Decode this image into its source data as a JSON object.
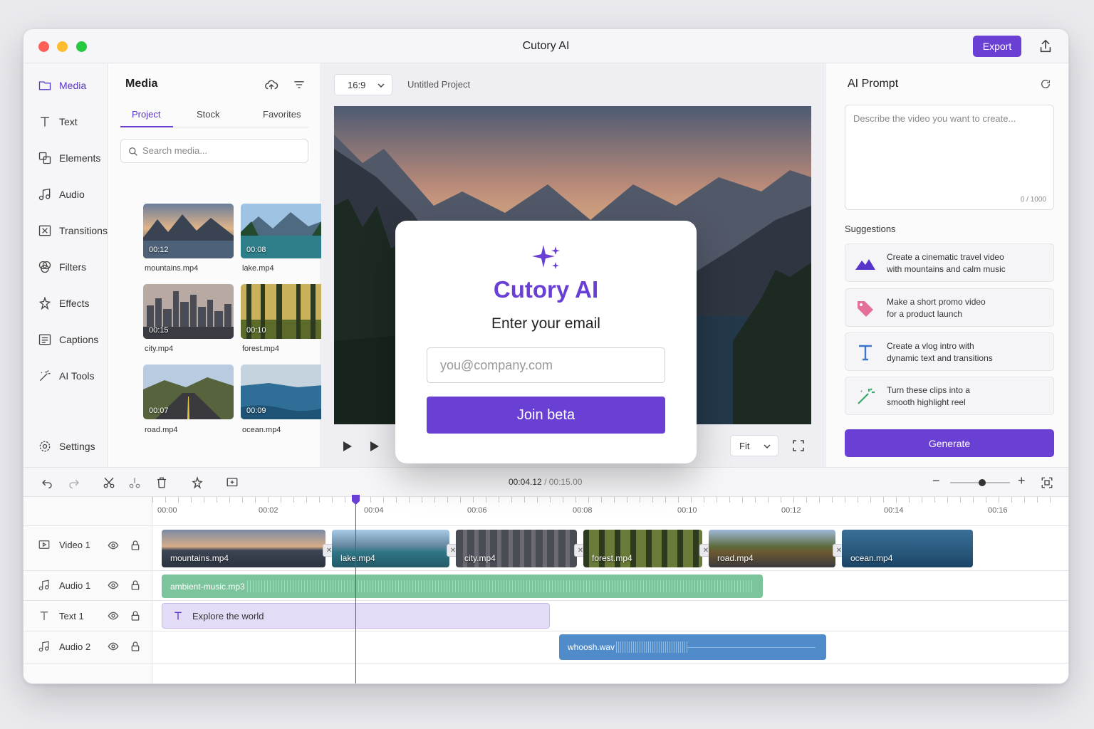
{
  "app": {
    "title": "Cutory AI",
    "export_label": "Export"
  },
  "nav": {
    "items": [
      {
        "label": "Media",
        "icon": "folder-icon"
      },
      {
        "label": "Text",
        "icon": "text-icon"
      },
      {
        "label": "Elements",
        "icon": "elements-icon"
      },
      {
        "label": "Audio",
        "icon": "music-note-icon"
      },
      {
        "label": "Transitions",
        "icon": "transitions-icon"
      },
      {
        "label": "Filters",
        "icon": "filters-icon"
      },
      {
        "label": "Effects",
        "icon": "effects-icon"
      },
      {
        "label": "Captions",
        "icon": "captions-icon"
      },
      {
        "label": "AI Tools",
        "icon": "magic-wand-icon"
      }
    ],
    "settings_label": "Settings"
  },
  "media": {
    "title": "Media",
    "tabs": [
      "Project",
      "Stock",
      "Favorites"
    ],
    "search_placeholder": "Search media...",
    "items": [
      {
        "name": "mountains.mp4",
        "duration": "00:12"
      },
      {
        "name": "lake.mp4",
        "duration": "00:08"
      },
      {
        "name": "city.mp4",
        "duration": "00:15"
      },
      {
        "name": "forest.mp4",
        "duration": "00:10"
      },
      {
        "name": "road.mp4",
        "duration": "00:07"
      },
      {
        "name": "ocean.mp4",
        "duration": "00:09"
      }
    ]
  },
  "preview": {
    "aspect_ratio": "16:9",
    "project_name": "Untitled Project",
    "fit_label": "Fit"
  },
  "ai": {
    "title": "AI Prompt",
    "placeholder": "Describe the video you want to create...",
    "char_count": "0 / 1000",
    "suggestions_title": "Suggestions",
    "suggestions": [
      {
        "text": "Create a cinematic travel video\nwith mountains and calm music",
        "icon": "mountain-icon"
      },
      {
        "text": "Make a short promo video\nfor a product launch",
        "icon": "tag-icon"
      },
      {
        "text": "Create a vlog intro with\ndynamic text and transitions",
        "icon": "text-icon"
      },
      {
        "text": "Turn these clips into a\nsmooth highlight reel",
        "icon": "magic-wand-icon"
      }
    ],
    "generate_label": "Generate"
  },
  "timeline": {
    "current_time": "00:04.12",
    "separator": "/",
    "total_time": "00:15.00",
    "ruler": [
      "00:00",
      "00:02",
      "00:04",
      "00:06",
      "00:08",
      "00:10",
      "00:12",
      "00:14",
      "00:16"
    ],
    "tracks": [
      "Video 1",
      "Audio 1",
      "Text 1",
      "Audio 2"
    ],
    "video_clips": [
      "mountains.mp4",
      "lake.mp4",
      "city.mp4",
      "forest.mp4",
      "road.mp4",
      "ocean.mp4"
    ],
    "audio1_clip": "ambient-music.mp3",
    "text_clip": "Explore the world",
    "audio2_clip": "whoosh.wav"
  },
  "modal": {
    "title": "Cutory AI",
    "subtitle": "Enter your email",
    "email_placeholder": "you@company.com",
    "button_label": "Join beta"
  },
  "colors": {
    "accent": "#6a3fd4",
    "audio1": "#7cc49b",
    "text_track": "#e4dcf6",
    "audio2": "#4f8cc9"
  }
}
